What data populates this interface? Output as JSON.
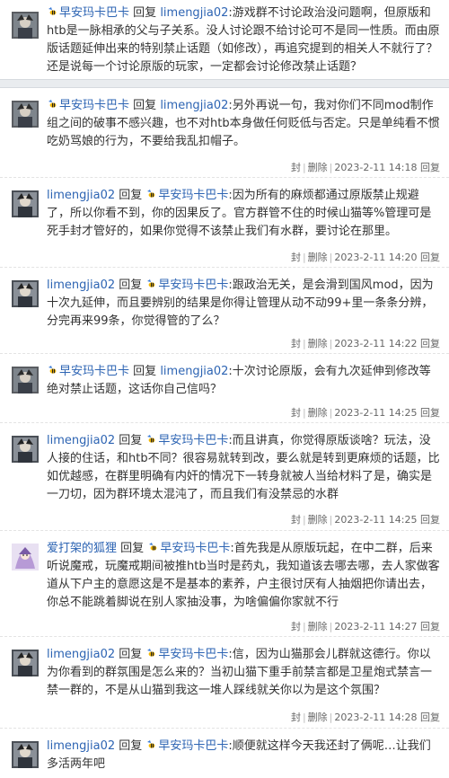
{
  "top_reply": {
    "author": "早安玛卡巴卡",
    "reply_word": "回复",
    "target": "limengjia02",
    "content": ":游戏群不讨论政治没问题啊，但原版和htb是一脉相承的父与子关系。没人讨论跟不给讨论可不是同一性质。而由原版话题延伸出来的特别禁止话题（如修改），再追究提到的相关人不就行了？还是说每一个讨论原版的玩家，一定都会讨论修改禁止话题？"
  },
  "actions": {
    "seal": "封",
    "delete": "删除",
    "reply": "回复"
  },
  "replies": [
    {
      "author": "早安玛卡巴卡",
      "author_has_badge": true,
      "reply_word": "回复",
      "target": "limengjia02",
      "target_has_badge": false,
      "content": ":另外再说一句，我对你们不同mod制作组之间的破事不感兴趣，也不对htb本身做任何贬低与否定。只是单纯看不惯吃奶骂娘的行为，不要给我乱扣帽子。",
      "time": "2023-2-11 14:18"
    },
    {
      "author": "limengjia02",
      "author_has_badge": false,
      "reply_word": "回复",
      "target": "早安玛卡巴卡",
      "target_has_badge": true,
      "content": ":因为所有的麻烦都通过原版禁止规避了，所以你看不到，你的因果反了。官方群管不住的时候山猫等%管理可是死手封才管好的，如果你觉得不该禁止我们有水群，要讨论在那里。",
      "time": "2023-2-11 14:20"
    },
    {
      "author": "limengjia02",
      "author_has_badge": false,
      "reply_word": "回复",
      "target": "早安玛卡巴卡",
      "target_has_badge": true,
      "content": ":跟政治无关，是会滑到国风mod，因为十次九延伸，而且要辨别的结果是你得让管理从动不动99+里一条条分辨，分完再来99条，你觉得管的了么？",
      "time": "2023-2-11 14:22"
    },
    {
      "author": "早安玛卡巴卡",
      "author_has_badge": true,
      "reply_word": "回复",
      "target": "limengjia02",
      "target_has_badge": false,
      "content": ":十次讨论原版，会有九次延伸到修改等绝对禁止话题，这话你自己信吗？",
      "time": "2023-2-11 14:25"
    },
    {
      "author": "limengjia02",
      "author_has_badge": false,
      "reply_word": "回复",
      "target": "早安玛卡巴卡",
      "target_has_badge": true,
      "content": ":而且讲真，你觉得原版谈啥？玩法，没人接的住话，和htb不同？很容易就转到改，要么就是转到更麻烦的话题，比如优越感，在群里明确有内奸的情况下一转身就被人当给材料了是，确实是一刀切，因为群环境太混沌了，而且我们有没禁忌的水群",
      "time": "2023-2-11 14:25"
    },
    {
      "author": "爱打架的狐狸",
      "author_has_badge": false,
      "reply_word": "回复",
      "target": "早安玛卡巴卡",
      "target_has_badge": true,
      "content": ":首先我是从原版玩起，在中二群，后来听说魔戒，玩魔戒期间被推htb当时是药丸，我知道该去哪去哪，去人家做客道从下户主的意愿这是不是基本的素养，户主很讨厌有人抽烟把你请出去，你总不能跳着脚说在别人家抽没事，为啥偏偏你家就不行",
      "time": "2023-2-11 14:27"
    },
    {
      "author": "limengjia02",
      "author_has_badge": false,
      "reply_word": "回复",
      "target": "早安玛卡巴卡",
      "target_has_badge": true,
      "content": ":信，因为山猫那会儿群就这德行。你以为你看到的群氛围是怎么来的？当初山猫下重手前禁言都是卫星炮式禁言一禁一群的，不是从山猫到我这一堆人踩线就关你以为是这个氛围？",
      "time": "2023-2-11 14:28"
    },
    {
      "author": "limengjia02",
      "author_has_badge": false,
      "reply_word": "回复",
      "target": "早安玛卡巴卡",
      "target_has_badge": true,
      "content": ":顺便就这样今天我还封了俩呢…让我们多活两年吧",
      "time": ""
    }
  ]
}
